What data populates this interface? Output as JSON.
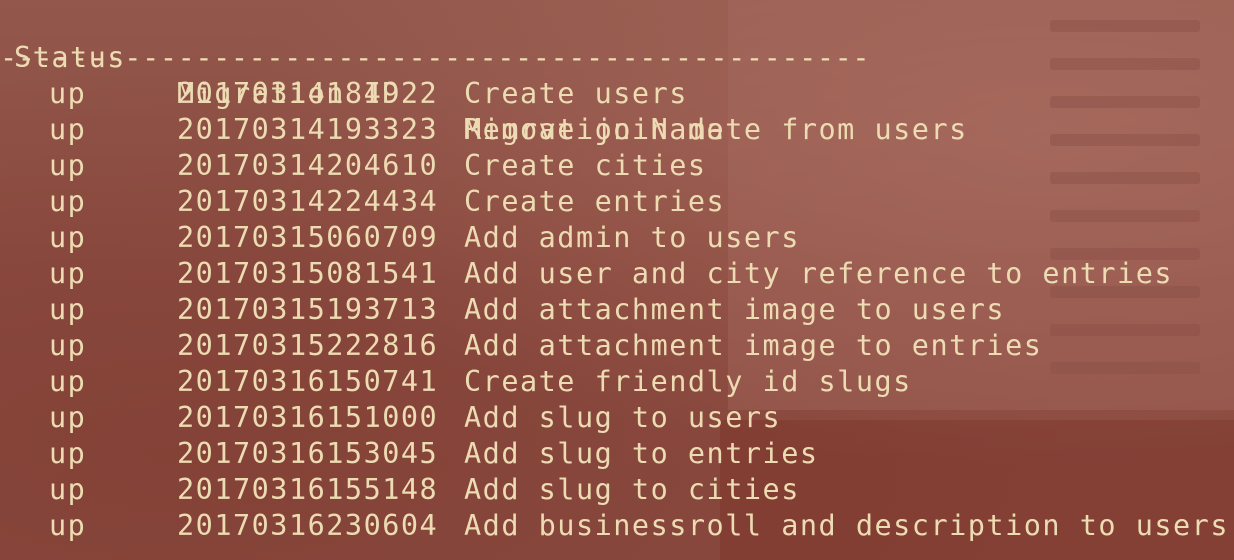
{
  "headers": {
    "status": "Status",
    "migration_id": "Migration ID",
    "migration_name": "Migration Name"
  },
  "separator": "-------------------------------------------------",
  "rows": [
    {
      "status": "up",
      "id": "20170314184922",
      "name": "Create users"
    },
    {
      "status": "up",
      "id": "20170314193323",
      "name": "Remove join date from users"
    },
    {
      "status": "up",
      "id": "20170314204610",
      "name": "Create cities"
    },
    {
      "status": "up",
      "id": "20170314224434",
      "name": "Create entries"
    },
    {
      "status": "up",
      "id": "20170315060709",
      "name": "Add admin to users"
    },
    {
      "status": "up",
      "id": "20170315081541",
      "name": "Add user and city reference to entries"
    },
    {
      "status": "up",
      "id": "20170315193713",
      "name": "Add attachment image to users"
    },
    {
      "status": "up",
      "id": "20170315222816",
      "name": "Add attachment image to entries"
    },
    {
      "status": "up",
      "id": "20170316150741",
      "name": "Create friendly id slugs"
    },
    {
      "status": "up",
      "id": "20170316151000",
      "name": "Add slug to users"
    },
    {
      "status": "up",
      "id": "20170316153045",
      "name": "Add slug to entries"
    },
    {
      "status": "up",
      "id": "20170316155148",
      "name": "Add slug to cities"
    },
    {
      "status": "up",
      "id": "20170316230604",
      "name": "Add businessroll and description to users"
    }
  ],
  "colors": {
    "text": "#eddcb3",
    "background": "#8a4a40"
  }
}
